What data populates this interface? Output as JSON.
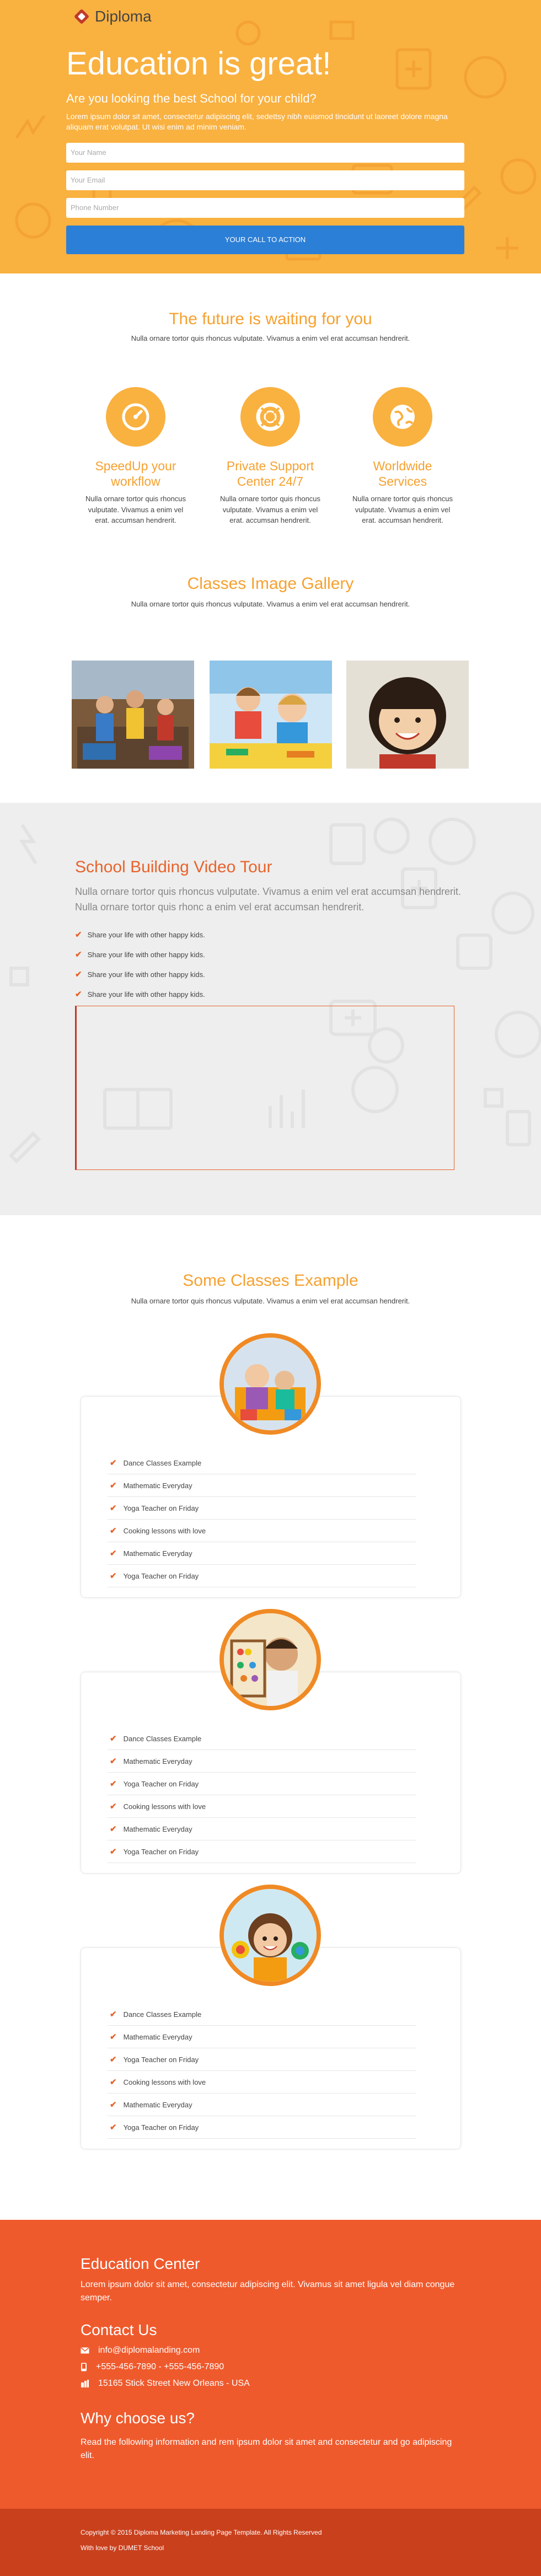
{
  "brand": {
    "name": "Diploma"
  },
  "hero": {
    "title": "Education is great!",
    "subtitle": "Are you looking the best School for your child?",
    "intro": "Lorem ipsum dolor sit amet, consectetur adipiscing elit, sedettsy nibh euismod tincidunt ut laoreet dolore magna aliquam erat volutpat. Ut wisi enim ad minim veniam.",
    "form": {
      "name_placeholder": "Your Name",
      "email_placeholder": "Your Email",
      "phone_placeholder": "Phone Number",
      "cta_label": "YOUR CALL TO ACTION"
    }
  },
  "features": {
    "title": "The future is waiting for you",
    "subtitle": "Nulla ornare tortor quis rhoncus vulputate. Vivamus a enim vel erat accumsan hendrerit.",
    "items": [
      {
        "title": "SpeedUp your workflow",
        "text": "Nulla ornare tortor quis rhoncus vulputate. Vivamus a enim vel erat. accumsan hendrerit.",
        "icon": "speedometer-icon"
      },
      {
        "title": "Private Support Center 24/7",
        "text": "Nulla ornare tortor quis rhoncus vulputate. Vivamus a enim vel erat. accumsan hendrerit.",
        "icon": "lifebuoy-icon"
      },
      {
        "title": "Worldwide Services",
        "text": "Nulla ornare tortor quis rhoncus vulputate. Vivamus a enim vel erat. accumsan hendrerit.",
        "icon": "globe-icon"
      }
    ]
  },
  "gallery": {
    "title": "Classes Image Gallery",
    "subtitle": "Nulla ornare tortor quis rhoncus vulputate. Vivamus a enim vel erat accumsan hendrerit."
  },
  "tour": {
    "title": "School Building Video Tour",
    "description": "Nulla ornare tortor quis rhoncus vulputate. Vivamus a enim vel erat accumsan hendrerit. Nulla ornare tortor quis rhonc a enim vel erat accumsan hendrerit.",
    "bullets": [
      "Share your life with other happy kids.",
      "Share your life with other happy kids.",
      "Share your life with other happy kids.",
      "Share your life with other happy kids."
    ]
  },
  "classes": {
    "title": "Some Classes Example",
    "subtitle": "Nulla ornare tortor quis rhoncus vulputate. Vivamus a enim vel erat accumsan hendrerit.",
    "cards": [
      {
        "items": [
          "Dance Classes Example",
          "Mathematic Everyday",
          "Yoga Teacher on Friday",
          "Cooking lessons with love",
          "Mathematic Everyday",
          "Yoga Teacher on Friday"
        ]
      },
      {
        "items": [
          "Dance Classes Example",
          "Mathematic Everyday",
          "Yoga Teacher on Friday",
          "Cooking lessons with love",
          "Mathematic Everyday",
          "Yoga Teacher on Friday"
        ]
      },
      {
        "items": [
          "Dance Classes Example",
          "Mathematic Everyday",
          "Yoga Teacher on Friday",
          "Cooking lessons with love",
          "Mathematic Everyday",
          "Yoga Teacher on Friday"
        ]
      }
    ]
  },
  "footer": {
    "education_title": "Education Center",
    "education_text": "Lorem ipsum dolor sit amet, consectetur adipiscing elit. Vivamus sit amet ligula vel diam congue semper.",
    "contact_title": "Contact Us",
    "email": "info@diplomalanding.com",
    "phones": "+555-456-7890 - +555-456-7890",
    "address": "15165 Stick Street New Orleans - USA",
    "why_title": "Why choose us?",
    "why_text": "Read the following information and rem ipsum dolor sit amet and consectetur and go adipiscing elit.",
    "copyright": "Copyright © 2015 Diploma Marketing Landing Page Template. All Rights Reserved",
    "credit": "With love by DUMET School"
  },
  "colors": {
    "hero_bg": "#f9b140",
    "accent_orange": "#f6a130",
    "cta_blue": "#2c7fd6",
    "tour_title": "#e8632b",
    "footer_bg": "#ef5a2d",
    "footer_bottom": "#c9401d"
  }
}
